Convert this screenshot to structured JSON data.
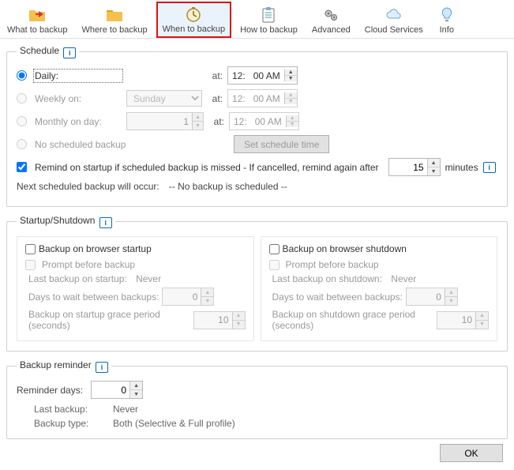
{
  "tabs": [
    {
      "label": "What to backup"
    },
    {
      "label": "Where to backup"
    },
    {
      "label": "When to backup"
    },
    {
      "label": "How to backup"
    },
    {
      "label": "Advanced"
    },
    {
      "label": "Cloud Services"
    },
    {
      "label": "Info"
    }
  ],
  "schedule": {
    "legend": "Schedule",
    "daily": {
      "label": "Daily:",
      "at": "at:",
      "time_h": "12:",
      "time_m": "00 AM"
    },
    "weekly": {
      "label": "Weekly on:",
      "day": "Sunday",
      "at": "at:",
      "time_h": "12:",
      "time_m": "00 AM"
    },
    "monthly": {
      "label": "Monthly on day:",
      "day": "1",
      "at": "at:",
      "time_h": "12:",
      "time_m": "00 AM"
    },
    "none": {
      "label": "No scheduled backup"
    },
    "set_btn": "Set schedule time",
    "remind": {
      "label": "Remind on startup if scheduled backup is missed - If cancelled, remind again after",
      "value": "15",
      "suffix": "minutes"
    },
    "next": {
      "label": "Next scheduled backup will occur:",
      "value": "-- No backup is scheduled  --"
    }
  },
  "ss": {
    "legend": "Startup/Shutdown",
    "startup": {
      "title": "Backup on browser startup",
      "prompt": "Prompt before backup",
      "last_k": "Last backup on startup:",
      "last_v": "Never",
      "days_k": "Days to wait between backups:",
      "days_v": "0",
      "grace_k": "Backup on startup grace period (seconds)",
      "grace_v": "10"
    },
    "shutdown": {
      "title": "Backup on browser shutdown",
      "prompt": "Prompt before backup",
      "last_k": "Last backup on shutdown:",
      "last_v": "Never",
      "days_k": "Days to wait between backups:",
      "days_v": "0",
      "grace_k": "Backup on shutdown grace period (seconds)",
      "grace_v": "10"
    }
  },
  "reminder": {
    "legend": "Backup reminder",
    "days_k": "Reminder days:",
    "days_v": "0",
    "last_k": "Last backup:",
    "last_v": "Never",
    "type_k": "Backup type:",
    "type_v": "Both  (Selective & Full profile)"
  },
  "footer": {
    "ok": "OK"
  }
}
